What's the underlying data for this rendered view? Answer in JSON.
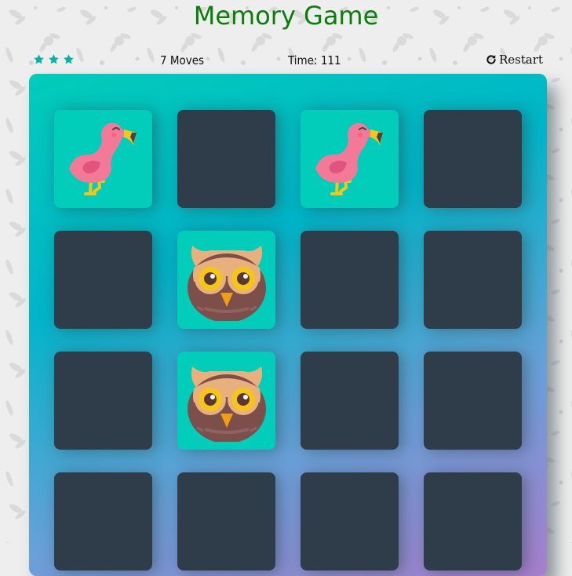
{
  "title": "Memory Game",
  "score": {
    "stars": 3,
    "moves": "7 Moves",
    "timer": "Time: 111",
    "restart_label": "Restart"
  },
  "colors": {
    "title": "#0a7d0a",
    "star": "#02b3a4",
    "card_closed": "#2e3d49",
    "card_open": "#02ccba"
  },
  "cards": [
    {
      "state": "open",
      "icon": "flamingo-icon"
    },
    {
      "state": "closed",
      "icon": ""
    },
    {
      "state": "open",
      "icon": "flamingo-icon"
    },
    {
      "state": "closed",
      "icon": ""
    },
    {
      "state": "closed",
      "icon": ""
    },
    {
      "state": "open",
      "icon": "owl-icon"
    },
    {
      "state": "closed",
      "icon": ""
    },
    {
      "state": "closed",
      "icon": ""
    },
    {
      "state": "closed",
      "icon": ""
    },
    {
      "state": "open",
      "icon": "owl-icon"
    },
    {
      "state": "closed",
      "icon": ""
    },
    {
      "state": "closed",
      "icon": ""
    },
    {
      "state": "closed",
      "icon": ""
    },
    {
      "state": "closed",
      "icon": ""
    },
    {
      "state": "closed",
      "icon": ""
    },
    {
      "state": "closed",
      "icon": ""
    }
  ]
}
